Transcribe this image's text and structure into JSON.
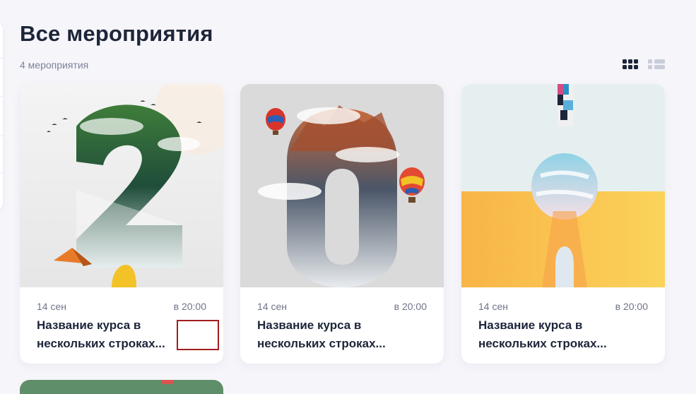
{
  "page": {
    "title": "Все мероприятия",
    "count_label": "4 мероприятия"
  },
  "view_toggle": {
    "active": "grid",
    "options": [
      "grid-icon",
      "list-icon"
    ]
  },
  "cards": [
    {
      "date": "14 сен",
      "time": "в 20:00",
      "title": "Название курса в нескольких строках...",
      "image": "number-2-forest-illustration"
    },
    {
      "date": "14 сен",
      "time": "в 20:00",
      "title": "Название курса в нескольких строках...",
      "image": "number-0-mountain-illustration"
    },
    {
      "date": "14 сен",
      "time": "в 20:00",
      "title": "Название курса в нескольких строках...",
      "image": "letter-i-sky-illustration"
    }
  ],
  "colors": {
    "background": "#f5f5fa",
    "card": "#ffffff",
    "title_text": "#1d2539",
    "muted_text": "#6f7589",
    "focus_outline": "#a31d1d"
  }
}
